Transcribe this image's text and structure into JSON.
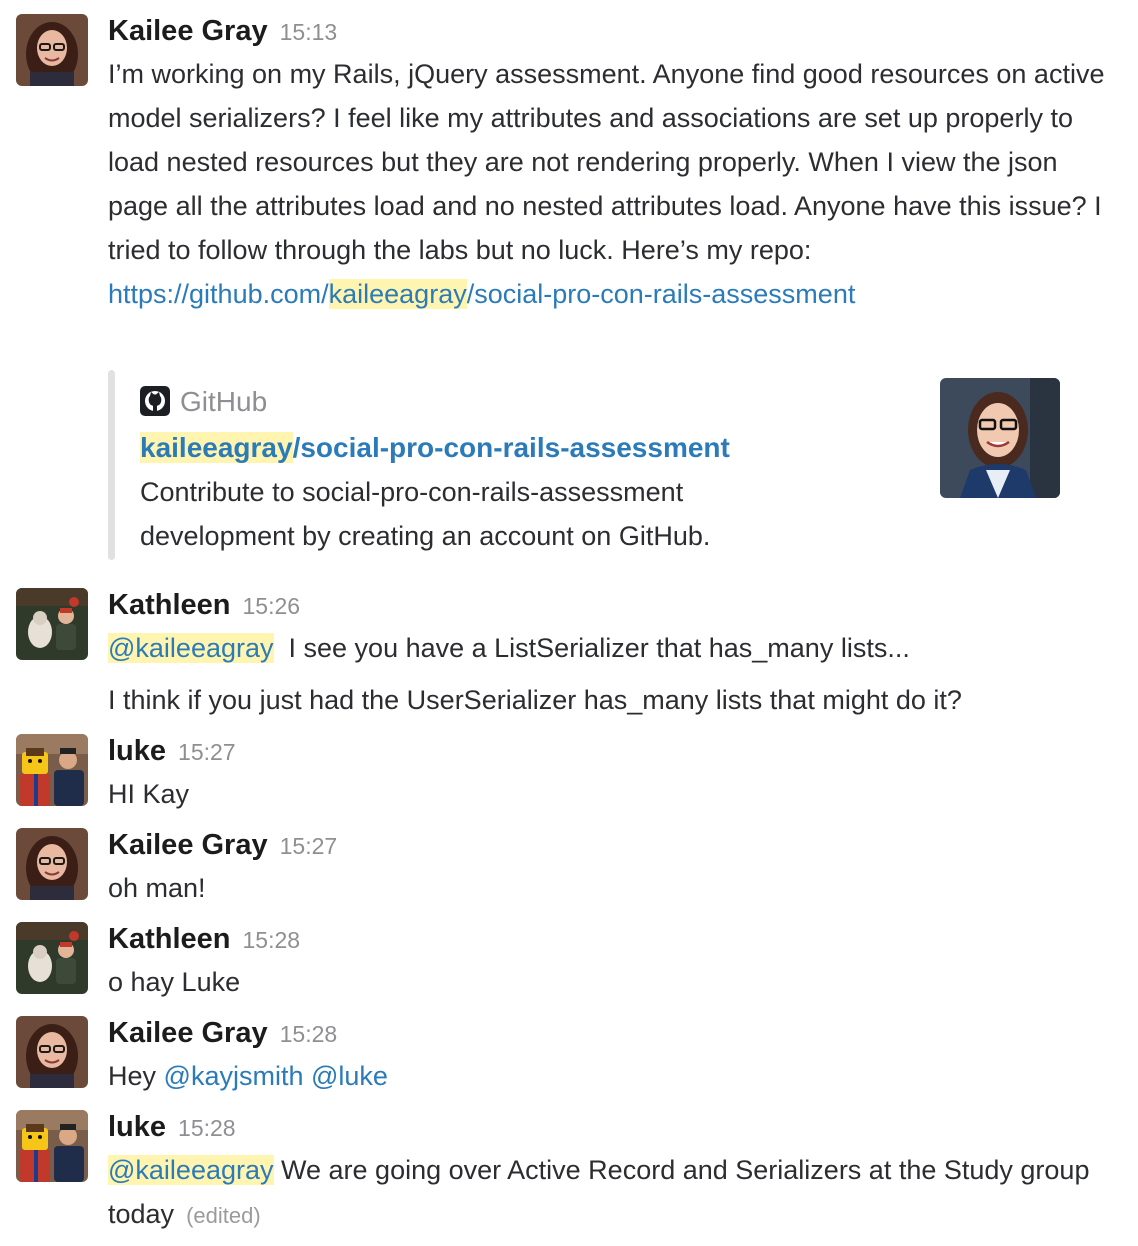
{
  "messages": [
    {
      "author": "Kailee Gray",
      "time": "15:13",
      "text_pre": "I’m working on my Rails, jQuery assessment. Anyone find good resources on active model serializers? I feel like my attributes and associations are set up properly to load nested resources but they are not rendering properly. When I view the json page all the attributes load and no nested attributes load. Anyone have this issue? I tried to follow through the labs but no luck. Here’s my repo:",
      "link_a": "https://github.com/",
      "link_b": "kaileeagray",
      "link_c": "/social-pro-con-rails-assessment",
      "attachment": {
        "service": "GitHub",
        "title_a": "kaileeagray",
        "title_b": "/social-pro-con-rails-assessment",
        "description": "Contribute to social-pro-con-rails-assessment development by creating an account on GitHub."
      }
    },
    {
      "author": "Kathleen",
      "time": "15:26",
      "mention": "@kaileeagray",
      "line1": "I see you have a ListSerializer that has_many lists...",
      "line2": "I think if you just had the UserSerializer has_many lists that might do it?"
    },
    {
      "author": "luke",
      "time": "15:27",
      "text": "HI Kay"
    },
    {
      "author": "Kailee Gray",
      "time": "15:27",
      "text": "oh man!"
    },
    {
      "author": "Kathleen",
      "time": "15:28",
      "text": "o hay Luke"
    },
    {
      "author": "Kailee Gray",
      "time": "15:28",
      "prefix": "Hey",
      "mention1": "@kayjsmith",
      "mention2": "@luke"
    },
    {
      "author": "luke",
      "time": "15:28",
      "mention": "@kaileeagray",
      "text": "We are going over Active Record and Serializers at the Study group today",
      "edited": "(edited)"
    }
  ],
  "colors": {
    "link": "#2b7bb9",
    "highlight": "#fff5b1",
    "name": "#1d1c1d",
    "timestamp": "#8f8f93"
  },
  "icons": {
    "attachment_service": "github-icon",
    "avatars": [
      "kailee-avatar",
      "kathleen-avatar",
      "luke-avatar"
    ]
  }
}
